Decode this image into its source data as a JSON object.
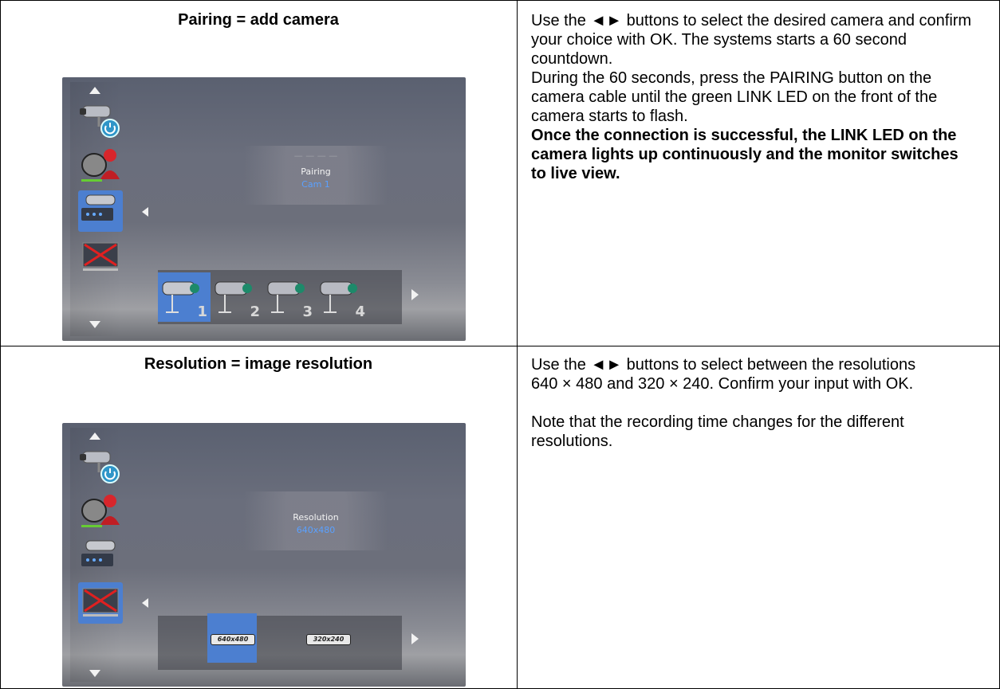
{
  "rows": [
    {
      "title": "Pairing = add camera",
      "description": [
        {
          "text": "Use the ◄► buttons to select the desired camera and confirm your choice with OK. The systems starts a 60 second countdown.",
          "bold": false
        },
        {
          "text": "During the 60 seconds, press the PAIRING button on the camera cable until the green LINK LED on the front of the camera starts to flash.",
          "bold": false
        },
        {
          "text": "Once the connection is successful, the LINK LED on the camera lights up continuously and the monitor switches to live view.",
          "bold": true
        }
      ],
      "screen": {
        "center_line1": "Pairing",
        "center_line2": "Cam 1",
        "options": [
          "1",
          "2",
          "3",
          "4"
        ],
        "selected_option": 0
      }
    },
    {
      "title": "Resolution = image resolution",
      "description": [
        {
          "text": "Use the ◄► buttons to select between the resolutions",
          "bold": false
        },
        {
          "text": "640 × 480 and 320 × 240. Confirm your input with OK.",
          "bold": false
        },
        {
          "text": "",
          "bold": false
        },
        {
          "text": "Note that the recording time changes for the different resolutions.",
          "bold": false
        }
      ],
      "screen": {
        "center_line1": "Resolution",
        "center_line2": "640x480",
        "options": [
          "640x480",
          "320x240"
        ],
        "selected_option": 0
      }
    }
  ],
  "colors": {
    "selection": "#4c7fd0",
    "highlight_text": "#5aa0ff"
  }
}
